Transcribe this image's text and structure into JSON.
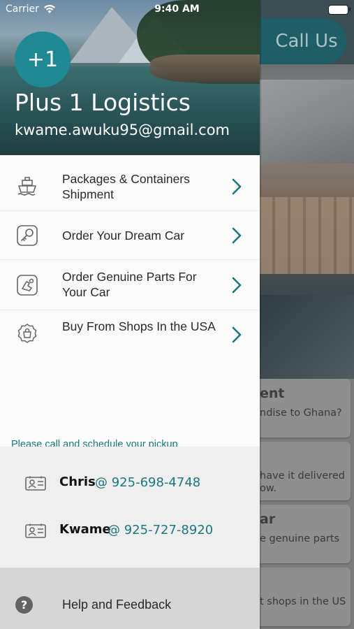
{
  "status_bar": {
    "carrier": "Carrier",
    "time": "9:40 AM"
  },
  "background": {
    "call_button_label": "Call Us",
    "cards": [
      {
        "title": "ent",
        "desc": [
          "ndise to Ghana?"
        ]
      },
      {
        "title": "",
        "desc": [
          "have it delivered",
          "ow."
        ]
      },
      {
        "title": "ar",
        "desc": [
          "e genuine parts"
        ]
      },
      {
        "title": "",
        "desc": [
          "t shops in the US"
        ]
      }
    ]
  },
  "drawer": {
    "avatar_text": "+1",
    "app_name": "Plus 1 Logistics",
    "email": "kwame.awuku95@gmail.com",
    "menu": [
      {
        "label": "Packages & Containers Shipment",
        "icon": "ship-icon"
      },
      {
        "label": "Order Your Dream Car",
        "icon": "car-key-icon"
      },
      {
        "label": "Order Genuine Parts For Your Car",
        "icon": "car-part-icon"
      },
      {
        "label": "Buy From Shops In the USA",
        "icon": "shopping-badge-icon"
      }
    ],
    "pickup_caption": "Please call and schedule your pickup",
    "contacts": [
      {
        "name": "Chris",
        "phone": "@ 925-698-4748"
      },
      {
        "name": "Kwame",
        "phone": "@ 925-727-8920"
      }
    ],
    "help_label": "Help and Feedback"
  },
  "colors": {
    "accent": "#1b7780",
    "avatar_bg": "#1f8a93"
  }
}
